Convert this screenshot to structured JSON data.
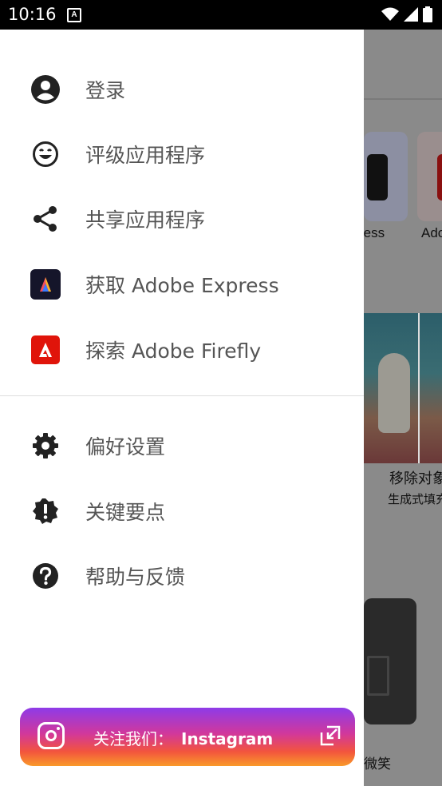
{
  "status_bar": {
    "time": "10:16",
    "notification_icon": "A"
  },
  "drawer": {
    "items_top": [
      {
        "label": "登录",
        "icon": "account-circle-icon"
      },
      {
        "label": "评级应用程序",
        "icon": "smiley-icon"
      },
      {
        "label": "共享应用程序",
        "icon": "share-icon"
      },
      {
        "label": "获取 Adobe Express",
        "icon": "adobe-express-icon"
      },
      {
        "label": "探索 Adobe Firefly",
        "icon": "adobe-firefly-icon"
      }
    ],
    "items_bottom": [
      {
        "label": "偏好设置",
        "icon": "gear-icon"
      },
      {
        "label": "关键要点",
        "icon": "alert-badge-icon"
      },
      {
        "label": "帮助与反馈",
        "icon": "help-circle-icon"
      }
    ],
    "instagram": {
      "prefix": "关注我们：",
      "name": "Instagram"
    }
  },
  "background_app": {
    "tile1_label": "ress",
    "tile2_label": "Ado",
    "photo_title": "移除对象",
    "photo_subtitle": "生成式填充",
    "card_label": "微笑"
  },
  "colors": {
    "express_bg": "#1a1a2e",
    "firefly_bg": "#e0140a",
    "scrim": "#8a8a8a"
  }
}
